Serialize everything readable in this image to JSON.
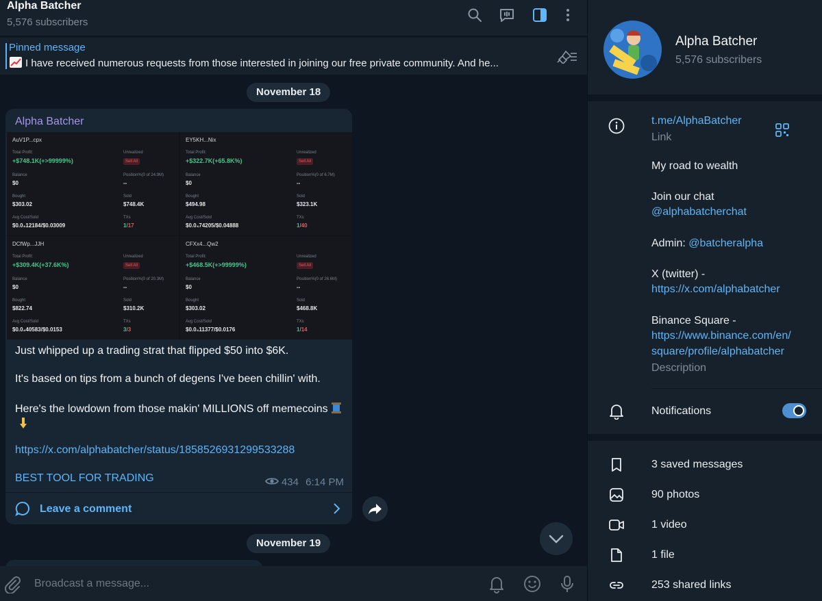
{
  "header": {
    "title": "Alpha Batcher",
    "subtitle": "5,576 subscribers",
    "icons": [
      "search-icon",
      "live-chat-icon",
      "sidebar-toggle-icon",
      "more-vertical-icon"
    ]
  },
  "pinned": {
    "label": "Pinned message",
    "emoji": "chart-increasing-icon",
    "text": "I have received numerous requests from those interested in joining our free private community. And he..."
  },
  "dates": [
    "November 18",
    "November 19"
  ],
  "message": {
    "sender": "Alpha Batcher",
    "cards": [
      {
        "head": "AuV1P...cpx",
        "total_profit_label": "Total Profit:",
        "total_profit": "+$748.1K(+>99999%)",
        "unrealized_label": "Unrealized",
        "sell_all": "Sell All",
        "balance_label": "Balance",
        "balance": "$0",
        "position_label": "Position%(0 of 24.9M)",
        "position": "--",
        "bought_label": "Bought",
        "bought": "$303.02",
        "sold_label": "Sold",
        "sold": "$748.4K",
        "avg_label": "Avg Cost/Sold",
        "avg": "$0.0₄12184/$0.03009",
        "txs_label": "TXs",
        "txs_win": "1",
        "txs_total": "17"
      },
      {
        "head": "EY5KH...Nix",
        "total_profit_label": "Total Profit:",
        "total_profit": "+$322.7K(+65.8K%)",
        "unrealized_label": "Unrealized",
        "sell_all": "Sell All",
        "balance_label": "Balance",
        "balance": "$0",
        "position_label": "Position%(0 of 6.7M)",
        "position": "--",
        "bought_label": "Bought",
        "bought": "$494.98",
        "sold_label": "Sold",
        "sold": "$323.1K",
        "avg_label": "Avg Cost/Sold",
        "avg": "$0.0₄74205/$0.04888",
        "txs_label": "TXs",
        "txs_win": "1",
        "txs_total": "40"
      },
      {
        "head": "DCfWp...JJH",
        "total_profit_label": "Total Profit:",
        "total_profit": "+$309.4K(+37.6K%)",
        "unrealized_label": "Unrealized",
        "sell_all": "Sell All",
        "balance_label": "Balance",
        "balance": "$0",
        "position_label": "Position%(0 of 20.3M)",
        "position": "--",
        "bought_label": "Bought",
        "bought": "$822.74",
        "sold_label": "Sold",
        "sold": "$310.2K",
        "avg_label": "Avg Cost/Sold",
        "avg": "$0.0₄40583/$0.0153",
        "txs_label": "TXs",
        "txs_win": "3",
        "txs_total": "3"
      },
      {
        "head": "CFXx4...Qw2",
        "total_profit_label": "Total Profit:",
        "total_profit": "+$468.5K(+>99999%)",
        "unrealized_label": "Unrealized",
        "sell_all": "Sell All",
        "balance_label": "Balance",
        "balance": "$0",
        "position_label": "Position%(0 of 26.6M)",
        "position": "--",
        "bought_label": "Bought",
        "bought": "$303.02",
        "sold_label": "Sold",
        "sold": "$468.8K",
        "avg_label": "Avg Cost/Sold",
        "avg": "$0.0₄11377/$0.0176",
        "txs_label": "TXs",
        "txs_win": "1",
        "txs_total": "14"
      }
    ],
    "line1": "Just whipped up a trading strat that flipped $50 into $6K.",
    "line2": "It's based on tips from a bunch of degens I've been chillin' with.",
    "line3": "Here's the lowdown from those makin' MILLIONS off memecoins",
    "line3_emoji": "thread-spool-icon",
    "line4_emoji": "pointing-down-icon",
    "link": "https://x.com/alphabatcher/status/1858526931299533288",
    "cta": "BEST TOOL FOR TRADING",
    "views": "434",
    "time": "6:14 PM",
    "comment_label": "Leave a comment"
  },
  "input": {
    "placeholder": "Broadcast a message..."
  },
  "profile": {
    "name": "Alpha Batcher",
    "subscribers": "5,576 subscribers",
    "link": "t.me/AlphaBatcher",
    "link_caption": "Link",
    "desc": {
      "l1": "My road to wealth",
      "l2": "Join our chat",
      "l3": "@alphabatcherchat",
      "l4a": "Admin: ",
      "l4b": "@batcheralpha",
      "l5": "X (twitter) -",
      "l6": "https://x.com/alphabatcher",
      "l7": "Binance Square -",
      "l8": "https://www.binance.com/en/",
      "l9": "square/profile/alphabatcher"
    },
    "desc_caption": "Description",
    "notifications": "Notifications",
    "notifications_on": true,
    "media": [
      {
        "icon": "bookmark-icon",
        "label": "3 saved messages"
      },
      {
        "icon": "photo-icon",
        "label": "90 photos"
      },
      {
        "icon": "video-icon",
        "label": "1 video"
      },
      {
        "icon": "file-icon",
        "label": "1 file"
      },
      {
        "icon": "link-icon",
        "label": "253 shared links"
      }
    ]
  },
  "colors": {
    "accent": "#5eb5f7",
    "sender": "#a695e7",
    "profit_green": "#4cc38a",
    "sell_red": "#e45a5a"
  }
}
